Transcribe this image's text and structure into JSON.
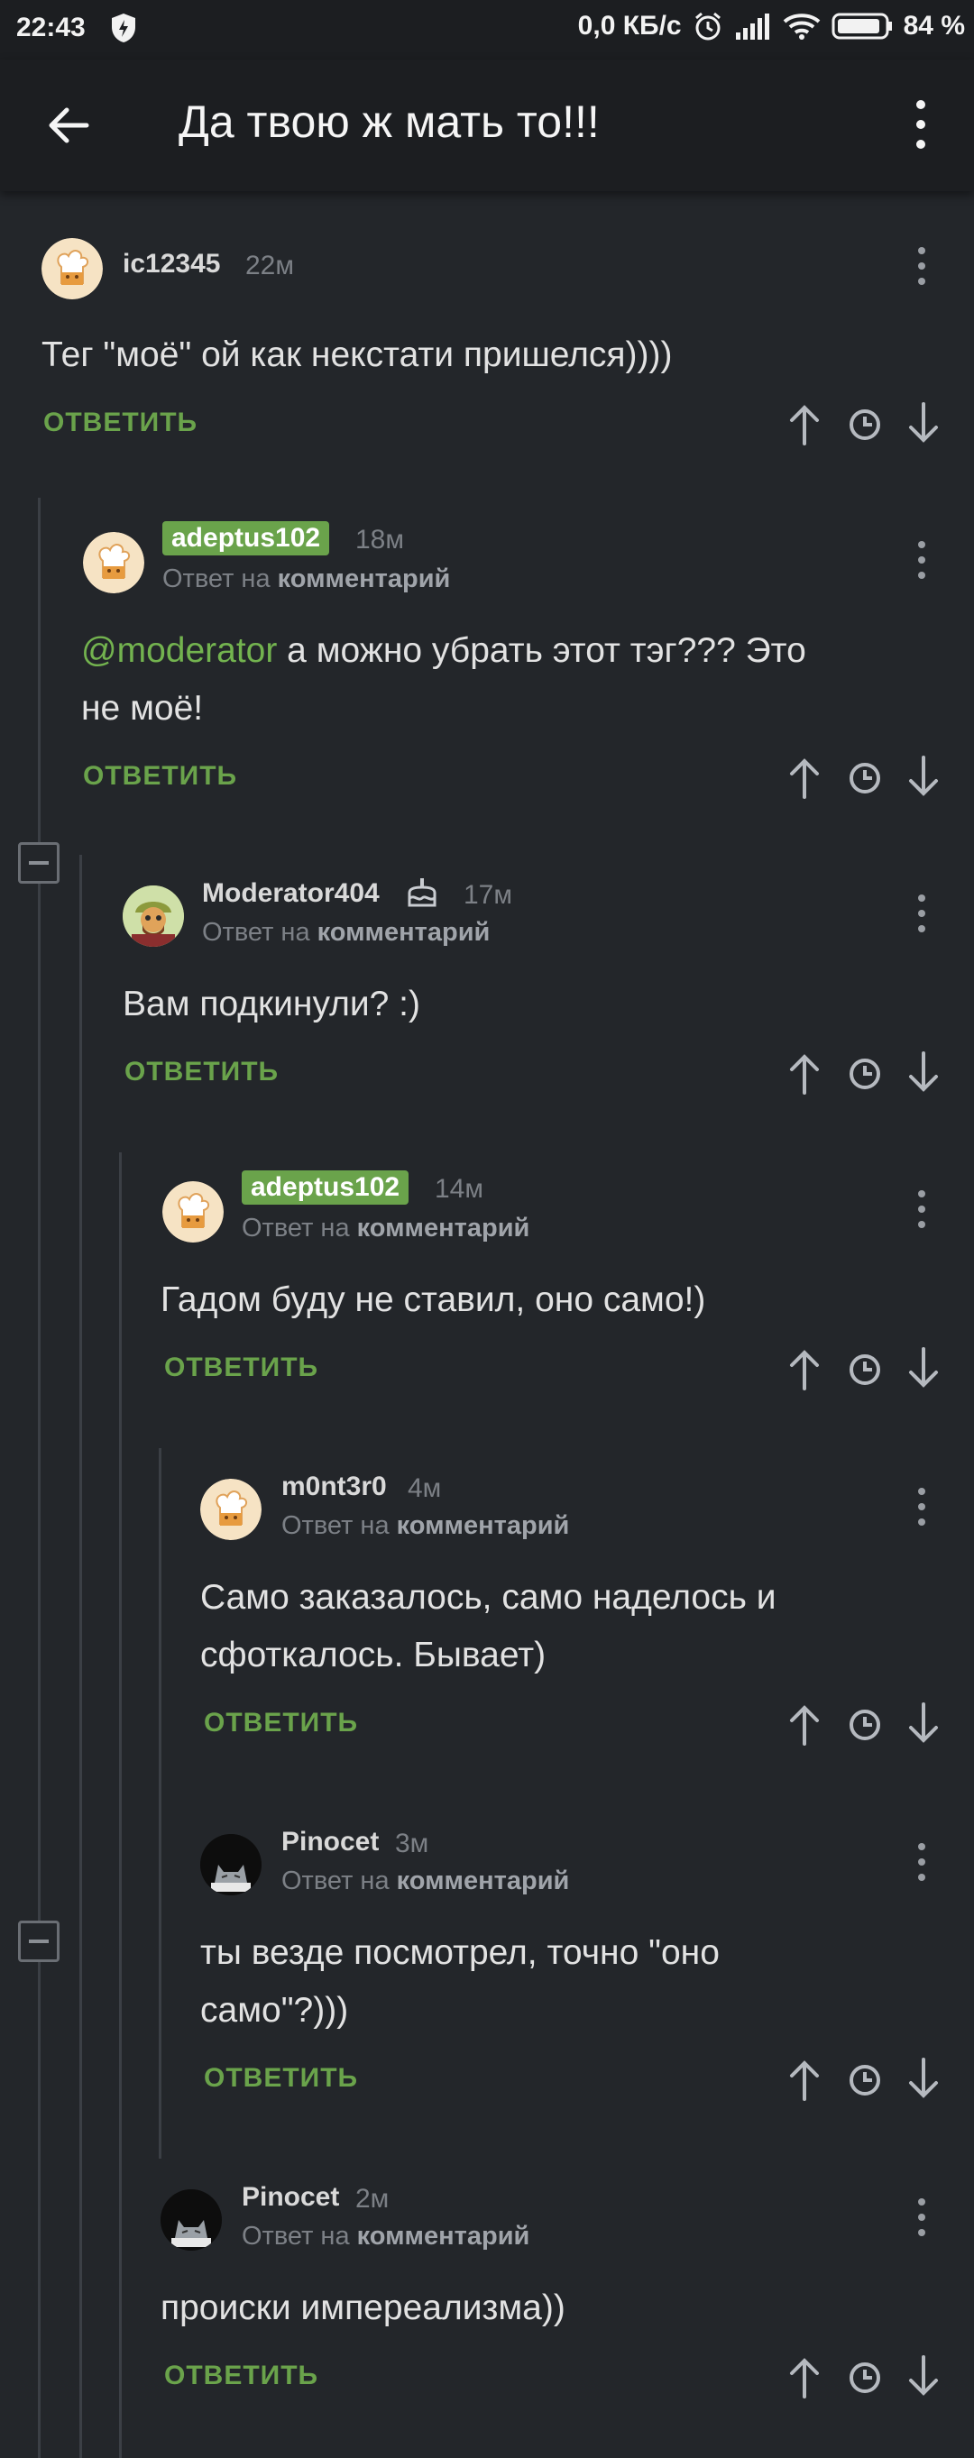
{
  "status_bar": {
    "time": "22:43",
    "network_speed": "0,0 КБ/с",
    "battery": "84 %"
  },
  "app_bar": {
    "title": "Да твою ж мать то!!!"
  },
  "colors": {
    "background": "#23262a",
    "accent_green": "#6aa34b",
    "muted": "#7c8086"
  },
  "comments": [
    {
      "user": "ic12345",
      "time": "22м",
      "reply_prefix": "",
      "reply_target": "",
      "text": "Тег \"моё\" ой как некстати пришелся))))",
      "reply_label": "ОТВЕТИТЬ",
      "avatar": "chef-icon"
    },
    {
      "user": "adeptus102",
      "time": "18м",
      "reply_prefix": "Ответ на",
      "reply_target": "комментарий",
      "mention": "@moderator",
      "text_line1": " а можно убрать этот тэг??? Это",
      "text_line2": "не моё!",
      "reply_label": "ОТВЕТИТЬ",
      "avatar": "chef-icon"
    },
    {
      "user": "Moderator404",
      "time": "17м",
      "reply_prefix": "Ответ на",
      "reply_target": "комментарий",
      "text": "Вам подкинули? :)",
      "reply_label": "ОТВЕТИТЬ",
      "avatar": "moderator-avatar",
      "badge": "cake-icon"
    },
    {
      "user": "adeptus102",
      "time": "14м",
      "reply_prefix": "Ответ на",
      "reply_target": "комментарий",
      "text": "Гадом буду не ставил, оно само!)",
      "reply_label": "ОТВЕТИТЬ",
      "avatar": "chef-icon"
    },
    {
      "user": "m0nt3r0",
      "time": "4м",
      "reply_prefix": "Ответ на",
      "reply_target": "комментарий",
      "text_line1": "Само заказалось, само наделось и",
      "text_line2": "сфоткалось. Бывает)",
      "reply_label": "ОТВЕТИТЬ",
      "avatar": "chef-icon"
    },
    {
      "user": "Pinocet",
      "time": "3м",
      "reply_prefix": "Ответ на",
      "reply_target": "комментарий",
      "text_line1": "ты везде посмотрел, точно \"оно",
      "text_line2": "само\"?)))",
      "reply_label": "ОТВЕТИТЬ",
      "avatar": "cat-avatar"
    },
    {
      "user": "Pinocet",
      "time": "2м",
      "reply_prefix": "Ответ на",
      "reply_target": "комментарий",
      "text": "происки импереализма))",
      "reply_label": "ОТВЕТИТЬ",
      "avatar": "cat-avatar"
    }
  ]
}
